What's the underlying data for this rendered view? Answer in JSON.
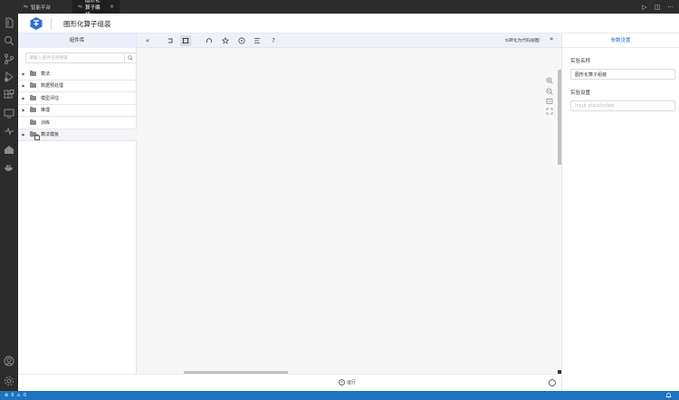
{
  "tabs": [
    {
      "label": "智能平台",
      "icon": "flow-icon"
    },
    {
      "label": "图形化算子编排",
      "icon": "flow-icon",
      "close": "×"
    }
  ],
  "window_controls": {
    "run": "▷",
    "split": "◫",
    "more": "···"
  },
  "header": {
    "title": "图形化算子组装"
  },
  "library": {
    "title": "组件库",
    "search_placeholder": "请输入组件名称搜索",
    "items": [
      {
        "label": "算法",
        "expandable": true
      },
      {
        "label": "数据预处理",
        "expandable": true
      },
      {
        "label": "模型评估",
        "expandable": true
      },
      {
        "label": "推理",
        "expandable": true
      },
      {
        "label": "训练",
        "expandable": false
      },
      {
        "label": "算法模板",
        "expandable": true
      }
    ]
  },
  "toolbar": {
    "collapse": "«",
    "convert_label": "转化为代码视图",
    "expand": "»"
  },
  "run_bar": {
    "run_label": "运行"
  },
  "props": {
    "title": "参数设置",
    "name_label": "实验名称",
    "name_value": "图形化算子组装",
    "settings_label": "实验设置",
    "settings_placeholder": "Input placeholder"
  },
  "statusbar": {
    "errors": "0",
    "warnings": "0",
    "bell": "🔔"
  },
  "colors": {
    "accent": "#2f6fd1",
    "statusbar": "#1e72c0",
    "activity_bar": "#2c2c2c"
  }
}
